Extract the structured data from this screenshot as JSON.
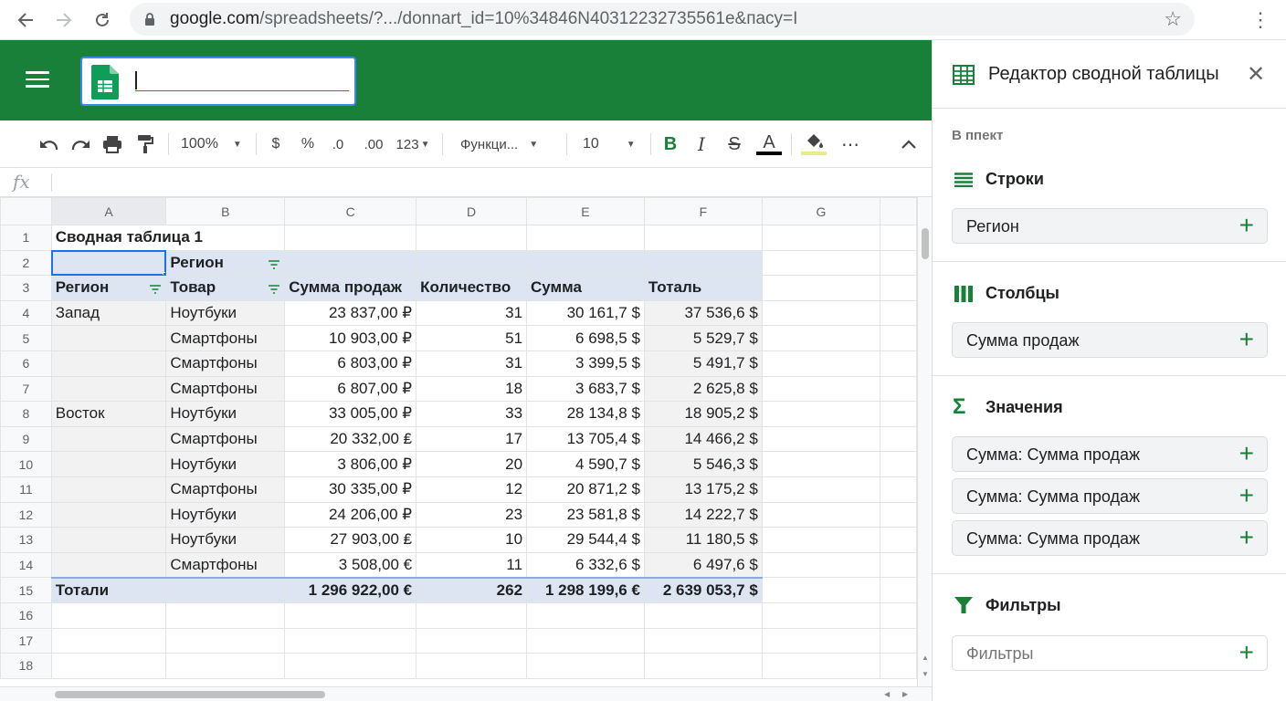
{
  "browser": {
    "url_host": "google.com",
    "url_path": "/spreadsheets/?.../donnart_id=10%34846N40312232735561e&пасу=I"
  },
  "doc": {
    "title_value": ""
  },
  "toolbar": {
    "zoom": "100%",
    "currency": "$",
    "percent": "%",
    "dec_decrease": ".0",
    "dec_increase": ".00",
    "format_more": "123",
    "font": "Функци...",
    "font_size": "10",
    "bold": "B",
    "italic": "I",
    "strike": "S",
    "text_color": "A",
    "more": "⋯"
  },
  "formula_bar": {
    "fx": "fx",
    "value": ""
  },
  "sheet": {
    "columns": [
      "A",
      "B",
      "C",
      "D",
      "E",
      "F",
      "G"
    ],
    "pivot_title": "Сводная таблица 1",
    "header_region2": "Регион",
    "headers": [
      "Регион",
      "Товар",
      "Сумма продаж",
      "Количество",
      "Сумма",
      "Тоталь"
    ],
    "rows": [
      {
        "n": "4",
        "region": "Запад",
        "product": "Ноутбуки",
        "sales": "23 837,00 ₽",
        "qty": "31",
        "sum": "30 161,7 $",
        "total": "37 536,6 $"
      },
      {
        "n": "5",
        "region": "",
        "product": "Смартфоны",
        "sales": "10 903,00 ₽",
        "qty": "51",
        "sum": "6 698,5 $",
        "total": "5 529,7 $"
      },
      {
        "n": "6",
        "region": "",
        "product": "Смартфоны",
        "sales": "6 803,00 ₽",
        "qty": "31",
        "sum": "3 399,5 $",
        "total": "5 491,7 $"
      },
      {
        "n": "7",
        "region": "",
        "product": "Смартфоны",
        "sales": "6 807,00 ₽",
        "qty": "18",
        "sum": "3 683,7 $",
        "total": "2 625,8 $"
      },
      {
        "n": "8",
        "region": "Восток",
        "product": "Ноутбуки",
        "sales": "33 005,00 ₽",
        "qty": "33",
        "sum": "28 134,8 $",
        "total": "18 905,2 $"
      },
      {
        "n": "9",
        "region": "",
        "product": "Смартфоны",
        "sales": "20 332,00 ₤",
        "qty": "17",
        "sum": "13 705,4 $",
        "total": "14 466,2 $"
      },
      {
        "n": "10",
        "region": "",
        "product": "Ноутбуки",
        "sales": "3 806,00 ₽",
        "qty": "20",
        "sum": "4 590,7 $",
        "total": "5 546,3 $"
      },
      {
        "n": "11",
        "region": "",
        "product": "Смартфоны",
        "sales": "30 335,00 ₽",
        "qty": "12",
        "sum": "20 871,2 $",
        "total": "13 175,2 $"
      },
      {
        "n": "12",
        "region": "",
        "product": "Ноутбуки",
        "sales": "24 206,00 ₽",
        "qty": "23",
        "sum": "23 581,8 $",
        "total": "14 222,7 $"
      },
      {
        "n": "13",
        "region": "",
        "product": "Ноутбуки",
        "sales": "27 903,00 ₤",
        "qty": "10",
        "sum": "29 544,4 $",
        "total": "11 180,5 $"
      },
      {
        "n": "14",
        "region": "",
        "product": "Смартфоны",
        "sales": "3 508,00 €",
        "qty": "11",
        "sum": "6 332,6 $",
        "total": "6 497,6 $"
      }
    ],
    "totals": {
      "n": "15",
      "label": "Тотали",
      "sales": "1 296 922,00 €",
      "qty": "262",
      "sum": "1 298 199,6 €",
      "total": "2 639 053,7 $"
    },
    "empty_rows": [
      "16",
      "17",
      "18"
    ]
  },
  "panel": {
    "title": "Редактор сводной таблицы",
    "subtitle": "В ппект",
    "rows_title": "Строки",
    "rows_chip": "Регион",
    "cols_title": "Столбцы",
    "cols_chip": "Сумма продаж",
    "values_title": "Значения",
    "values_chips": [
      "Сумма: Сумма продаж",
      "Сумма: Сумма продаж",
      "Сумма: Сумма продаж"
    ],
    "filters_title": "Фильтры",
    "filters_chip": "Фильтры"
  },
  "colors": {
    "brand_green": "#188038",
    "pivot_highlight": "#dde5f3",
    "selection_blue": "#1a73e8"
  },
  "icons": [
    "back-arrow-icon",
    "forward-arrow-icon",
    "reload-icon",
    "lock-icon",
    "star-icon",
    "kebab-menu-icon",
    "hamburger-icon",
    "sheets-logo-icon",
    "undo-icon",
    "redo-icon",
    "print-icon",
    "paint-format-icon",
    "fill-color-icon",
    "collapse-chevron-icon",
    "filter-icon",
    "table-icon",
    "close-icon",
    "rows-icon",
    "columns-icon",
    "sigma-icon",
    "funnel-icon",
    "plus-icon"
  ]
}
